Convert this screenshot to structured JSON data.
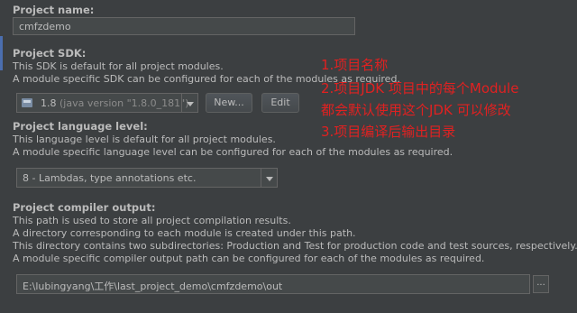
{
  "project_name": {
    "label": "Project name:",
    "value": "cmfzdemo"
  },
  "project_sdk": {
    "label": "Project SDK:",
    "desc1": "This SDK is default for all project modules.",
    "desc2": "A module specific SDK can be configured for each of the modules as required.",
    "selected_name": "1.8",
    "selected_version": "(java version \"1.8.0_181\")",
    "new_button": "New...",
    "edit_button": "Edit"
  },
  "language_level": {
    "label": "Project language level:",
    "desc1": "This language level is default for all project modules.",
    "desc2": "A module specific language level can be configured for each of the modules as required.",
    "selected": "8 - Lambdas, type annotations etc."
  },
  "compiler_output": {
    "label": "Project compiler output:",
    "desc1": "This path is used to store all project compilation results.",
    "desc2": "A directory corresponding to each module is created under this path.",
    "desc3": "This directory contains two subdirectories: Production and Test for production code and test sources, respectively.",
    "desc4": "A module specific compiler output path can be configured for each of the modules as required.",
    "path": "E:\\lubingyang\\工作\\last_project_demo\\cmfzdemo\\out",
    "browse_button": "..."
  },
  "annotations": {
    "line1": "1.项目名称",
    "line2": "2.项目JDK 项目中的每个Module",
    "line3": "都会默认使用这个JDK 可以修改",
    "line4": "3.项目编译后输出目录"
  },
  "colors": {
    "background": "#3c3f41",
    "annotation": "#e02121",
    "accent": "#4b6eaf"
  }
}
